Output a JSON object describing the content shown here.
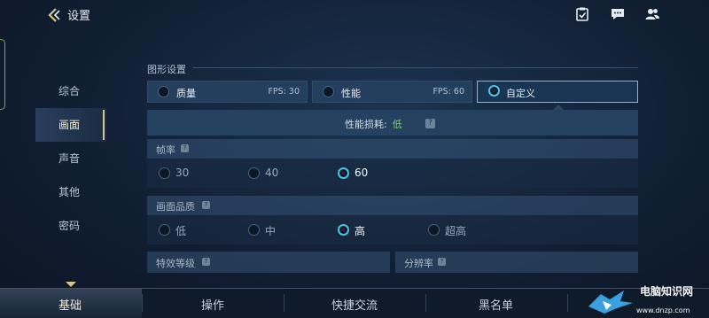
{
  "header": {
    "title": "设置",
    "icons": [
      "back-arrow-icon",
      "clipboard-check-icon",
      "chat-bubble-icon",
      "friends-icon"
    ]
  },
  "sidebar": {
    "items": [
      {
        "label": "综合",
        "active": false
      },
      {
        "label": "画面",
        "active": true
      },
      {
        "label": "声音",
        "active": false
      },
      {
        "label": "其他",
        "active": false
      },
      {
        "label": "密码",
        "active": false
      }
    ]
  },
  "graphics": {
    "section_title": "图形设置",
    "presets": [
      {
        "label": "质量",
        "fps": "FPS: 30",
        "selected": false
      },
      {
        "label": "性能",
        "fps": "FPS: 60",
        "selected": false
      },
      {
        "label": "自定义",
        "fps": "",
        "selected": true
      }
    ],
    "perf_label": "性能损耗:",
    "perf_value": "低",
    "frame_rate": {
      "title": "帧率",
      "options": [
        {
          "label": "30",
          "selected": false
        },
        {
          "label": "40",
          "selected": false
        },
        {
          "label": "60",
          "selected": true
        }
      ]
    },
    "image_quality": {
      "title": "画面品质",
      "options": [
        {
          "label": "低",
          "selected": false
        },
        {
          "label": "中",
          "selected": false
        },
        {
          "label": "高",
          "selected": true
        },
        {
          "label": "超高",
          "selected": false
        }
      ]
    },
    "effects_title": "特效等级",
    "resolution_title": "分辨率"
  },
  "bottom_nav": {
    "items": [
      {
        "label": "基础",
        "active": true
      },
      {
        "label": "操作",
        "active": false
      },
      {
        "label": "快捷交流",
        "active": false
      },
      {
        "label": "黑名单",
        "active": false
      }
    ]
  },
  "watermark": {
    "line1": "电脑知识网",
    "line2": "www.dnzp.com"
  },
  "colors": {
    "accent_gold": "#d7c48a",
    "radio_selected": "#4fc3e8",
    "perf_good": "#79d36b",
    "panel": "#243f5e",
    "background": "#111f33"
  }
}
